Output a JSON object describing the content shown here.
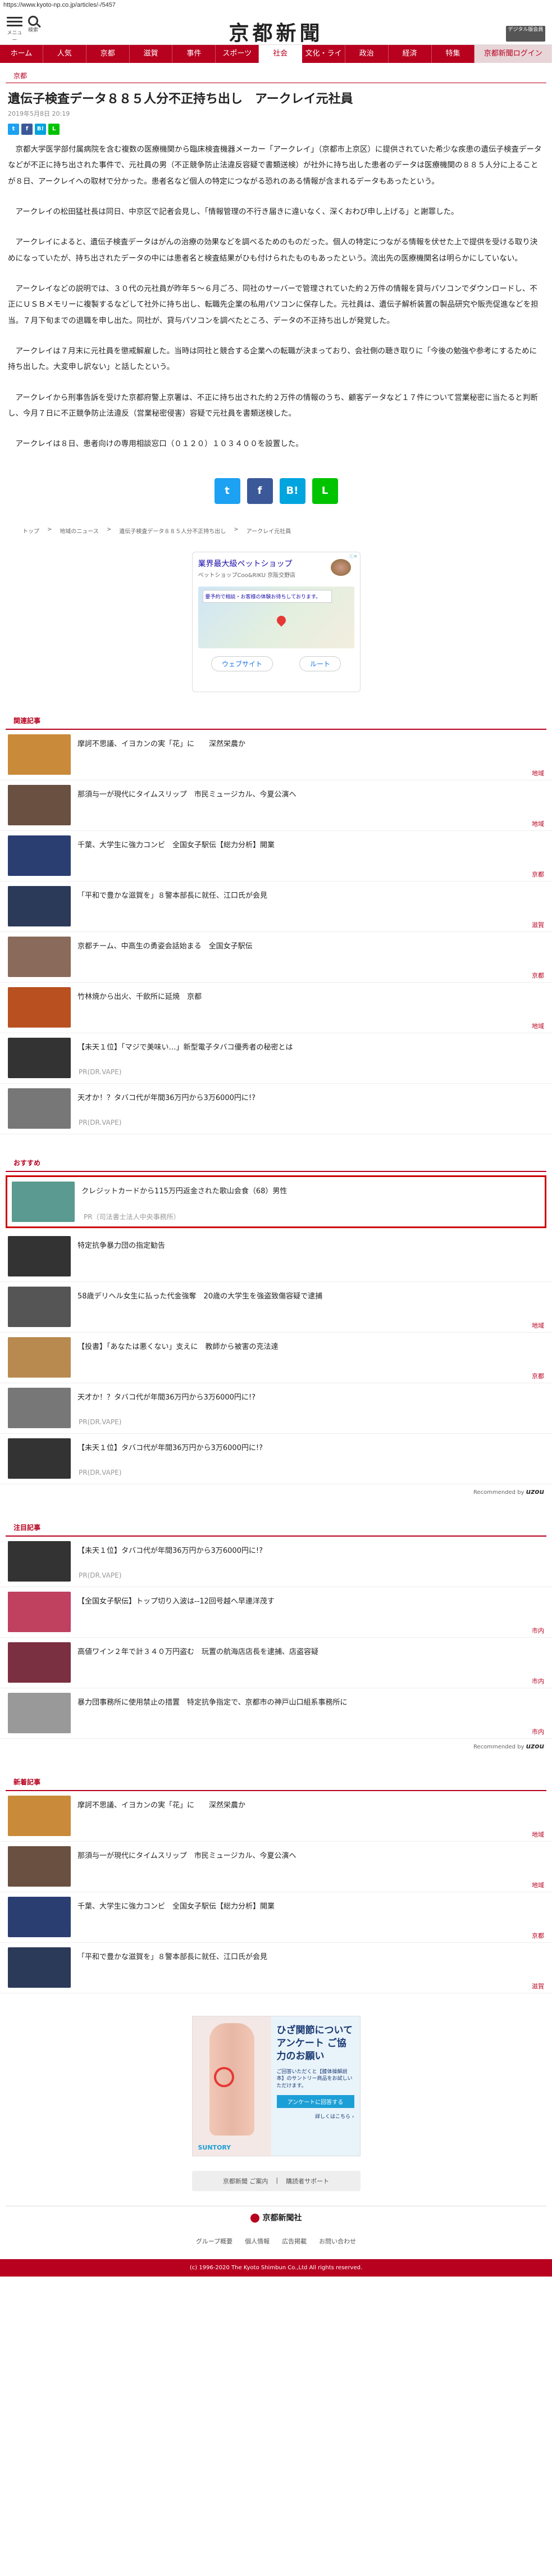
{
  "url": "https://www.kyoto-np.co.jp/articles/-/5457",
  "header": {
    "menu_label": "メニュー",
    "search_label": "検索",
    "logo": "京都新聞",
    "digital_button": "デジタル版会員"
  },
  "nav": [
    "ホーム",
    "人気",
    "京都",
    "滋賀",
    "事件",
    "スポーツ",
    "社会",
    "文化・ライフ",
    "政治",
    "経済",
    "特集",
    "京都新聞ログイン"
  ],
  "article": {
    "section": "京都",
    "title": "遺伝子検査データ８８５人分不正持ち出し　アークレイ元社員",
    "date": "2019年5月8日 20:19",
    "paragraphs": [
      "京都大学医学部付属病院を含む複数の医療機関から臨床検査機器メーカー「アークレイ」（京都市上京区）に提供されていた希少な疾患の遺伝子検査データなどが不正に持ち出された事件で、元社員の男（不正競争防止法違反容疑で書類送検）が社外に持ち出した患者のデータは医療機関の８８５人分に上ることが８日、アークレイへの取材で分かった。患者名など個人の特定につながる恐れのある情報が含まれるデータもあったという。",
      "アークレイの松田猛社長は同日、中京区で記者会見し、「情報管理の不行き届きに違いなく、深くおわび申し上げる」と謝罪した。",
      "アークレイによると、遺伝子検査データはがんの治療の効果などを調べるためのものだった。個人の特定につながる情報を伏せた上で提供を受ける取り決めになっていたが、持ち出されたデータの中には患者名と検査結果がひも付けられたものもあったという。流出先の医療機関名は明らかにしていない。",
      "アークレイなどの説明では、３０代の元社員が昨年５～６月ごろ、同社のサーバーで管理されていた約２万件の情報を貸与パソコンでダウンロードし、不正にＵＳＢメモリーに複製するなどして社外に持ち出し、転職先企業の私用パソコンに保存した。元社員は、遺伝子解析装置の製品研究や販売促進などを担当。７月下旬までの退職を申し出た。同社が、貸与パソコンを調べたところ、データの不正持ち出しが発覚した。",
      "アークレイは７月末に元社員を懲戒解雇した。当時は同社と競合する企業への転職が決まっており、会社側の聴き取りに「今後の勉強や参考にするために持ち出した。大変申し訳ない」と話したという。",
      "アークレイから刑事告訴を受けた京都府警上京署は、不正に持ち出された約２万件の情報のうち、顧客データなど１７件について営業秘密に当たると判断し、今月７日に不正競争防止法違反（営業秘密侵害）容疑で元社員を書類送検した。",
      "アークレイは８日、患者向けの専用相談窓口（０１２０）１０３４００を設置した。"
    ]
  },
  "share": {
    "twitter": "t",
    "facebook": "f",
    "hatena": "B!",
    "line": "L"
  },
  "breadcrumb": [
    "トップ",
    "地域のニュース",
    "遺伝子検査データ８８５人分不正持ち出し",
    "アークレイ元社員"
  ],
  "ad1": {
    "title": "業界最大級ペットショップ",
    "sub": "ペットショップCoo&RIKU 京阪交野店",
    "banner": "要予約で相談・お客様の体験お待ちしております。",
    "btn_route": "ルート",
    "btn_web": "ウェブサイト",
    "badge": "ⓘ✕"
  },
  "related": {
    "heading": "関連記事",
    "items": [
      {
        "text": "摩訶不思議、イヨカンの実「花」に　　深然栄農か",
        "region": "地域",
        "color": "#c98a3a"
      },
      {
        "text": "那須与一が現代にタイムスリップ　市民ミュージカル、今夏公演へ",
        "region": "地域",
        "color": "#6a5040"
      },
      {
        "text": "千葉、大学生に強力コンビ　全国女子駅伝【総力分析】開業",
        "region": "京都",
        "color": "#2a3e72"
      },
      {
        "text": "「平和で豊かな滋賀を」８警本部長に就任、江口氏が会見",
        "region": "滋賀",
        "color": "#2c3a5a"
      },
      {
        "text": "京都チーム、中高生の勇姿会話始まる　全国女子駅伝",
        "region": "京都",
        "color": "#8a6a5a"
      },
      {
        "text": "竹林焼から出火、千飲所に延焼　京都",
        "region": "地域",
        "color": "#b85020"
      },
      {
        "text": "【未天１位】「マジで美味い…」新型電子タバコ優秀者の秘密とは",
        "pr": "PR(DR.VAPE)",
        "color": "#333"
      },
      {
        "text": "天才か！？タバコ代が年間36万円から3万6000円に!?",
        "pr": "PR(DR.VAPE)",
        "color": "#777"
      }
    ]
  },
  "recommend": {
    "heading": "おすすめ",
    "items": [
      {
        "text": "クレジットカードから115万円返金された歌山会食（68）男性",
        "pr": "PR（司法書士法人中央事務所）",
        "color": "#5a9a90",
        "highlight": true
      },
      {
        "text": "特定抗争暴力団の指定勧告",
        "color": "#333"
      },
      {
        "text": "58歳デリヘル女生に払った代金強奪　20歳の大学生を強盗致傷容疑で逮捕",
        "region": "地域",
        "color": "#555"
      },
      {
        "text": "【投書】「あなたは悪くない」支えに　教師から被害の克法達",
        "region": "京都",
        "color": "#b88a50"
      },
      {
        "text": "天才か！？タバコ代が年間36万円から3万6000円に!?",
        "pr": "PR(DR.VAPE)",
        "color": "#777"
      },
      {
        "text": "【未天１位】タバコ代が年間36万円から3万6000円に!?",
        "pr": "PR(DR.VAPE)",
        "color": "#333"
      }
    ],
    "recommended_by": "Recommended by",
    "brand": "uzou"
  },
  "attention": {
    "heading": "注目記事",
    "items": [
      {
        "text": "【未天１位】タバコ代が年間36万円から3万6000円に!?",
        "pr": "PR(DR.VAPE)",
        "color": "#333"
      },
      {
        "text": "【全国女子駅伝】トップ切り入波は--12回号越へ早連洋茂す",
        "region": "市内",
        "color": "#c04060"
      },
      {
        "text": "高値ワイン２年で計３４０万円盗む　玩置の航海店店長を逮捕、店盗容疑",
        "region": "市内",
        "color": "#7a3040"
      },
      {
        "text": "暴力団事務所に使用禁止の措置　特定抗争指定で、京都市の神戸山口組系事務所に",
        "region": "市内",
        "color": "#999"
      }
    ],
    "recommended_by": "Recommended by",
    "brand": "uzou"
  },
  "latest": {
    "heading": "新着記事",
    "items": [
      {
        "text": "摩訶不思議、イヨカンの実「花」に　　深然栄農か",
        "region": "地域",
        "color": "#c98a3a"
      },
      {
        "text": "那須与一が現代にタイムスリップ　市民ミュージカル、今夏公演へ",
        "region": "地域",
        "color": "#6a5040"
      },
      {
        "text": "千葉、大学生に強力コンビ　全国女子駅伝【総力分析】開業",
        "region": "京都",
        "color": "#2a3e72"
      },
      {
        "text": "「平和で豊かな滋賀を」８警本部長に就任、江口氏が会見",
        "region": "滋賀",
        "color": "#2c3a5a"
      }
    ]
  },
  "ad2": {
    "headline": "ひざ関節について アンケート ご協力のお願い",
    "body": "ご回答いただくと【膝体操解説本】のサントリー商品をお試しいただけます。",
    "button": "アンケートに回答する",
    "more": "詳しくはこちら ›",
    "brand": "SUNTORY"
  },
  "footer": {
    "links": [
      "京都新聞 ご案内",
      "購読者サポート"
    ],
    "logo": "京都新聞社",
    "nav": [
      "グループ概要",
      "個人情報",
      "広告掲載",
      "お問い合わせ"
    ],
    "copyright": "(c) 1996-2020 The Kyoto Shimbun Co.,Ltd All rights reserved."
  }
}
